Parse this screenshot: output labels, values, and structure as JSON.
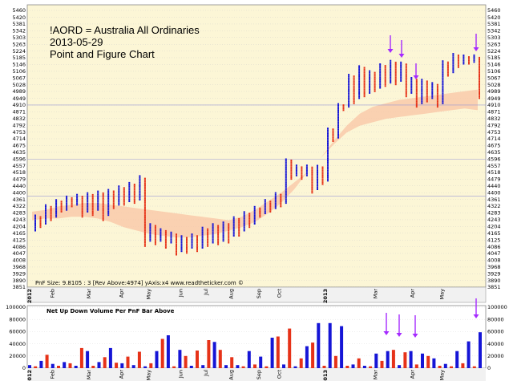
{
  "chart_data": [
    {
      "type": "scatter",
      "subtype": "point-and-figure",
      "title_lines": [
        "!AORD = Australia All Ordinaries",
        "2013-05-29",
        "Point and Figure Chart"
      ],
      "footer": "PnF Size: 9.8105 : 3  [Rev Above:4974]  yAxis:x4  www.readtheticker.com ©",
      "y_ticks": [
        5460,
        5420,
        5381,
        5342,
        5303,
        5263,
        5224,
        5185,
        5146,
        5106,
        5067,
        5028,
        4989,
        4949,
        4910,
        4871,
        4832,
        4792,
        4753,
        4714,
        4675,
        4635,
        4596,
        4557,
        4518,
        4479,
        4440,
        4400,
        4361,
        4322,
        4283,
        4243,
        4204,
        4165,
        4125,
        4086,
        4047,
        4008,
        3968,
        3929,
        3890,
        3851
      ],
      "ylim": [
        3851,
        5460
      ],
      "x_ticks": [
        "2012",
        "Feb",
        "Mar",
        "Apr",
        "May",
        "Jun",
        "Jul",
        "Aug",
        "Sep",
        "Oct",
        "2013",
        "Mar",
        "Apr",
        "May"
      ],
      "bold_x_ticks": [
        "2012",
        "2013"
      ],
      "grid": true,
      "columns": [
        {
          "dir": "x",
          "low": 4180,
          "high": 4270
        },
        {
          "dir": "o",
          "low": 4200,
          "high": 4260
        },
        {
          "dir": "x",
          "low": 4220,
          "high": 4330
        },
        {
          "dir": "o",
          "low": 4240,
          "high": 4320
        },
        {
          "dir": "x",
          "low": 4260,
          "high": 4360
        },
        {
          "dir": "o",
          "low": 4290,
          "high": 4350
        },
        {
          "dir": "x",
          "low": 4300,
          "high": 4380
        },
        {
          "dir": "o",
          "low": 4320,
          "high": 4370
        },
        {
          "dir": "x",
          "low": 4330,
          "high": 4390
        },
        {
          "dir": "o",
          "low": 4260,
          "high": 4380
        },
        {
          "dir": "x",
          "low": 4290,
          "high": 4400
        },
        {
          "dir": "o",
          "low": 4270,
          "high": 4390
        },
        {
          "dir": "x",
          "low": 4300,
          "high": 4410
        },
        {
          "dir": "o",
          "low": 4240,
          "high": 4400
        },
        {
          "dir": "x",
          "low": 4270,
          "high": 4420
        },
        {
          "dir": "o",
          "low": 4310,
          "high": 4410
        },
        {
          "dir": "x",
          "low": 4330,
          "high": 4440
        },
        {
          "dir": "o",
          "low": 4330,
          "high": 4430
        },
        {
          "dir": "x",
          "low": 4350,
          "high": 4460
        },
        {
          "dir": "o",
          "low": 4340,
          "high": 4450
        },
        {
          "dir": "x",
          "low": 4360,
          "high": 4500
        },
        {
          "dir": "o",
          "low": 4090,
          "high": 4490
        },
        {
          "dir": "x",
          "low": 4120,
          "high": 4220
        },
        {
          "dir": "o",
          "low": 4100,
          "high": 4210
        },
        {
          "dir": "x",
          "low": 4120,
          "high": 4190
        },
        {
          "dir": "o",
          "low": 4080,
          "high": 4180
        },
        {
          "dir": "x",
          "low": 4110,
          "high": 4170
        },
        {
          "dir": "o",
          "low": 4040,
          "high": 4160
        },
        {
          "dir": "x",
          "low": 4060,
          "high": 4150
        },
        {
          "dir": "o",
          "low": 4050,
          "high": 4140
        },
        {
          "dir": "x",
          "low": 4080,
          "high": 4160
        },
        {
          "dir": "o",
          "low": 4060,
          "high": 4150
        },
        {
          "dir": "x",
          "low": 4080,
          "high": 4200
        },
        {
          "dir": "o",
          "low": 4090,
          "high": 4190
        },
        {
          "dir": "x",
          "low": 4110,
          "high": 4220
        },
        {
          "dir": "o",
          "low": 4100,
          "high": 4210
        },
        {
          "dir": "x",
          "low": 4120,
          "high": 4230
        },
        {
          "dir": "o",
          "low": 4110,
          "high": 4220
        },
        {
          "dir": "x",
          "low": 4150,
          "high": 4260
        },
        {
          "dir": "o",
          "low": 4150,
          "high": 4250
        },
        {
          "dir": "x",
          "low": 4180,
          "high": 4290
        },
        {
          "dir": "o",
          "low": 4200,
          "high": 4280
        },
        {
          "dir": "x",
          "low": 4220,
          "high": 4320
        },
        {
          "dir": "o",
          "low": 4260,
          "high": 4310
        },
        {
          "dir": "x",
          "low": 4280,
          "high": 4360
        },
        {
          "dir": "o",
          "low": 4290,
          "high": 4350
        },
        {
          "dir": "x",
          "low": 4310,
          "high": 4400
        },
        {
          "dir": "o",
          "low": 4320,
          "high": 4390
        },
        {
          "dir": "x",
          "low": 4340,
          "high": 4600
        },
        {
          "dir": "o",
          "low": 4480,
          "high": 4590
        },
        {
          "dir": "x",
          "low": 4500,
          "high": 4560
        },
        {
          "dir": "o",
          "low": 4480,
          "high": 4550
        },
        {
          "dir": "x",
          "low": 4500,
          "high": 4560
        },
        {
          "dir": "o",
          "low": 4400,
          "high": 4550
        },
        {
          "dir": "x",
          "low": 4420,
          "high": 4560
        },
        {
          "dir": "o",
          "low": 4450,
          "high": 4550
        },
        {
          "dir": "x",
          "low": 4470,
          "high": 4780
        },
        {
          "dir": "o",
          "low": 4700,
          "high": 4770
        },
        {
          "dir": "x",
          "low": 4720,
          "high": 4920
        },
        {
          "dir": "o",
          "low": 4880,
          "high": 4910
        },
        {
          "dir": "x",
          "low": 4900,
          "high": 5090
        },
        {
          "dir": "o",
          "low": 4920,
          "high": 5080
        },
        {
          "dir": "x",
          "low": 4950,
          "high": 5140
        },
        {
          "dir": "o",
          "low": 4960,
          "high": 5130
        },
        {
          "dir": "x",
          "low": 4980,
          "high": 5110
        },
        {
          "dir": "o",
          "low": 4990,
          "high": 5100
        },
        {
          "dir": "x",
          "low": 5010,
          "high": 5150
        },
        {
          "dir": "o",
          "low": 5020,
          "high": 5140
        },
        {
          "dir": "x",
          "low": 5040,
          "high": 5170
        },
        {
          "dir": "o",
          "low": 5030,
          "high": 5160
        },
        {
          "dir": "x",
          "low": 5050,
          "high": 5160
        },
        {
          "dir": "o",
          "low": 4960,
          "high": 5150
        },
        {
          "dir": "x",
          "low": 4980,
          "high": 5070
        },
        {
          "dir": "o",
          "low": 4900,
          "high": 5060
        },
        {
          "dir": "x",
          "low": 4920,
          "high": 5060
        },
        {
          "dir": "o",
          "low": 4930,
          "high": 5050
        },
        {
          "dir": "x",
          "low": 4950,
          "high": 5040
        },
        {
          "dir": "o",
          "low": 4900,
          "high": 5030
        },
        {
          "dir": "x",
          "low": 4920,
          "high": 5170
        },
        {
          "dir": "o",
          "low": 5080,
          "high": 5160
        },
        {
          "dir": "x",
          "low": 5100,
          "high": 5210
        },
        {
          "dir": "o",
          "low": 5130,
          "high": 5200
        },
        {
          "dir": "x",
          "low": 5150,
          "high": 5200
        },
        {
          "dir": "o",
          "low": 5150,
          "high": 5190
        },
        {
          "dir": "x",
          "low": 5160,
          "high": 5200
        },
        {
          "dir": "o",
          "low": 4950,
          "high": 5190
        }
      ],
      "band": {
        "upper": [
          4290,
          4300,
          4320,
          4330,
          4340,
          4340,
          4330,
          4320,
          4310,
          4300,
          4290,
          4280,
          4270,
          4260,
          4250,
          4240,
          4260,
          4300,
          4350,
          4400,
          4460,
          4520,
          4600,
          4700,
          4790,
          4860,
          4900,
          4920,
          4940,
          4950,
          4960,
          4970,
          4980,
          4990,
          5000
        ],
        "lower": [
          4240,
          4250,
          4250,
          4260,
          4260,
          4250,
          4230,
          4200,
          4180,
          4160,
          4150,
          4140,
          4140,
          4150,
          4160,
          4180,
          4200,
          4230,
          4280,
          4340,
          4420,
          4520,
          4600,
          4680,
          4750,
          4790,
          4810,
          4830,
          4840,
          4850,
          4860,
          4870,
          4880,
          4890,
          4880
        ]
      },
      "horizontal_lines": [
        4910,
        4596,
        4381
      ],
      "arrows": [
        "down",
        "down",
        "down",
        "down"
      ],
      "colors": {
        "x": "#1515d6",
        "o": "#e63218",
        "band": "#f9c4a4",
        "background": "#fcf6d6",
        "grid": "#c8c8c8",
        "arrow": "#a52aff"
      }
    },
    {
      "type": "bar",
      "title": "Net Up Down Volume Per PnF Bar Above",
      "y_ticks": [
        "100000",
        "80000",
        "60000",
        "40000",
        "20000",
        "0"
      ],
      "ylim": [
        0,
        100000
      ],
      "values": [
        5000,
        3000,
        12000,
        22000,
        7000,
        4000,
        10000,
        8000,
        4000,
        33000,
        28000,
        4000,
        10000,
        18000,
        33000,
        9000,
        8000,
        19000,
        5000,
        27000,
        3000,
        8000,
        28000,
        48000,
        54000,
        3000,
        30000,
        20000,
        4000,
        29000,
        5000,
        46000,
        43000,
        30000,
        5000,
        18000,
        5000,
        3000,
        28000,
        6000,
        19000,
        3000,
        50000,
        52000,
        6000,
        65000,
        3000,
        16000,
        36000,
        42000,
        74000,
        4000,
        74000,
        20000,
        69000,
        4000,
        6000,
        16000,
        4000,
        3000,
        24000,
        12000,
        28000,
        30000,
        5000,
        26000,
        28000,
        6000,
        24000,
        20000,
        16000,
        4000,
        7000,
        3000,
        28000,
        8000,
        44000,
        3000,
        59000
      ],
      "colors": [
        "#1515d6",
        "#e63218"
      ],
      "arrows": [
        "down",
        "down",
        "down",
        "down"
      ]
    }
  ]
}
